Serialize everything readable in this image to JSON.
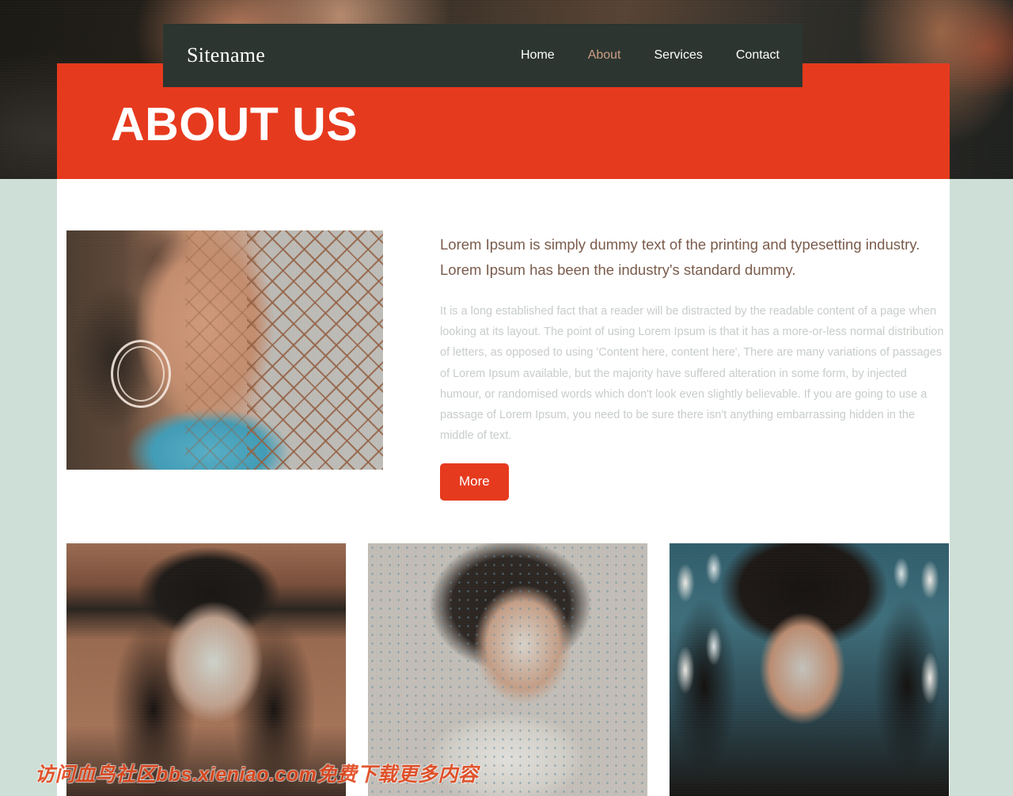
{
  "site": {
    "brand": "Sitename",
    "page_title": "ABOUT US"
  },
  "colors": {
    "accent_red": "#e63a1e",
    "nav_dark": "#2c3530",
    "page_background": "#cddfd6",
    "active_link": "#cd9d85",
    "lead_text": "#7a5c4c",
    "body_text": "#c7cdc9"
  },
  "nav": {
    "items": [
      {
        "label": "Home",
        "active": false
      },
      {
        "label": "About",
        "active": true
      },
      {
        "label": "Services",
        "active": false
      },
      {
        "label": "Contact",
        "active": false
      }
    ]
  },
  "about": {
    "image_alt": "portrait-woman-hoop-earrings-fence",
    "lead": "Lorem Ipsum is simply dummy text of the printing and typesetting industry. Lorem Ipsum has been the industry's standard dummy.",
    "body": "It is a long established fact that a reader will be distracted by the readable content of a page when looking at its layout. The point of using Lorem Ipsum is that it has a more-or-less normal distribution of letters, as opposed to using 'Content here, content here', There are many variations of passages of Lorem Ipsum available, but the majority have suffered alteration in some form, by injected humour, or randomised words which don't look even slightly believable. If you are going to use a passage of Lorem Ipsum, you need to be sure there isn't anything embarrassing hidden in the middle of text.",
    "more_label": "More"
  },
  "gallery": {
    "items": [
      {
        "alt": "portrait-woman-black-beret"
      },
      {
        "alt": "portrait-woman-bob-heart-hands"
      },
      {
        "alt": "portrait-woman-dark-fringe-lights"
      }
    ]
  },
  "watermark": {
    "text": "访问血鸟社区bbs.xieniao.com免费下载更多内容"
  }
}
